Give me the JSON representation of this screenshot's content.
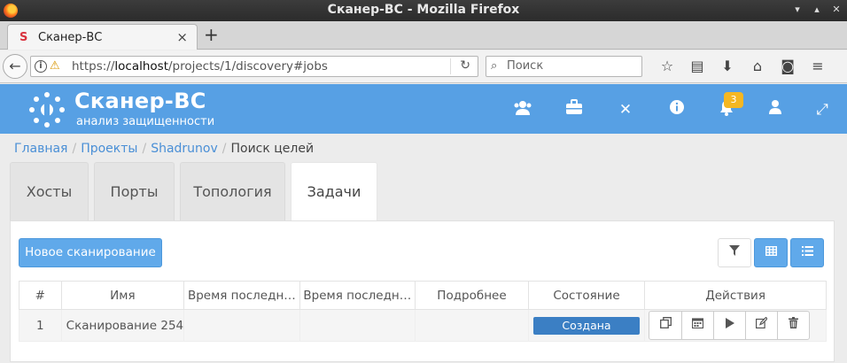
{
  "window": {
    "title": "Сканер-ВС - Mozilla Firefox"
  },
  "browser": {
    "tab_title": "Сканер-ВС",
    "url_host": "localhost",
    "url_prefix": "https://",
    "url_path": "/projects/1/discovery#jobs",
    "search_placeholder": "Поиск"
  },
  "app": {
    "logo_title": "Сканер-ВС",
    "logo_subtitle": "анализ защищенности",
    "notifications_count": "3",
    "accent_color": "#57a0e4"
  },
  "breadcrumb": {
    "items": [
      "Главная",
      "Проекты",
      "Shadrunov"
    ],
    "current": "Поиск целей"
  },
  "tabs": [
    "Хосты",
    "Порты",
    "Топология",
    "Задачи"
  ],
  "active_tab": "Задачи",
  "toolbar": {
    "new_scan_label": "Новое сканирование"
  },
  "table": {
    "columns": [
      "#",
      "Имя",
      "Время последн…",
      "Время последн…",
      "Подробнее",
      "Состояние",
      "Действия"
    ],
    "rows": [
      {
        "num": "1",
        "name": "Сканирование 254",
        "last_time_1": "",
        "last_time_2": "",
        "details": "",
        "status": "Создана"
      }
    ]
  }
}
